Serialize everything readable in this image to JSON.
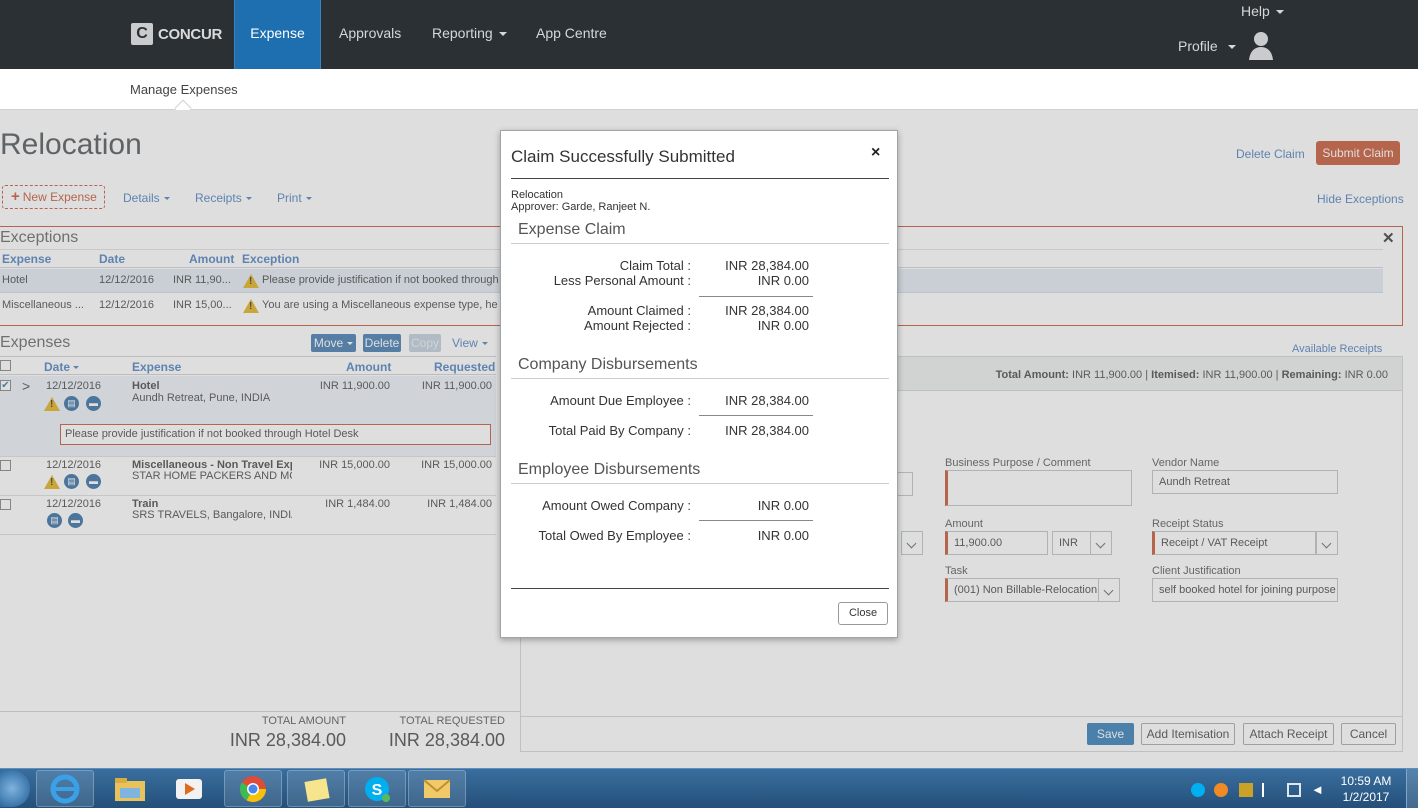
{
  "nav": {
    "logo_mark": "C",
    "logo_text": "CONCUR",
    "items": [
      "Expense",
      "Approvals",
      "Reporting",
      "App Centre"
    ],
    "help": "Help",
    "profile": "Profile"
  },
  "subnav": {
    "tab": "Manage Expenses"
  },
  "page": {
    "title": "Relocation",
    "delete_claim": "Delete Claim",
    "submit_claim": "Submit Claim",
    "new_expense": "New Expense",
    "toolbar": [
      "Details",
      "Receipts",
      "Print"
    ],
    "hide_exceptions": "Hide Exceptions"
  },
  "exceptions": {
    "title": "Exceptions",
    "headers": [
      "Expense",
      "Date",
      "Amount",
      "Exception"
    ],
    "rows": [
      {
        "expense": "Hotel",
        "date": "12/12/2016",
        "amount": "INR 11,90...",
        "text": "Please provide justification if not booked through"
      },
      {
        "expense": "Miscellaneous ...",
        "date": "12/12/2016",
        "amount": "INR 15,00...",
        "text": "You are using a Miscellaneous expense type, her"
      }
    ]
  },
  "expenses": {
    "title": "Expenses",
    "buttons": [
      "Move",
      "Delete",
      "Copy",
      "View"
    ],
    "headers": [
      "Date",
      "Expense",
      "Amount",
      "Requested"
    ],
    "rows": [
      {
        "date": "12/12/2016",
        "name": "Hotel",
        "detail": "Aundh Retreat, Pune, INDIA",
        "amount": "INR 11,900.00",
        "requested": "INR 11,900.00"
      },
      {
        "date": "12/12/2016",
        "name": "Miscellaneous - Non Travel Exp",
        "detail": "STAR HOME PACKERS AND MC",
        "amount": "INR 15,000.00",
        "requested": "INR 15,000.00"
      },
      {
        "date": "12/12/2016",
        "name": "Train",
        "detail": "SRS TRAVELS, Bangalore, INDIA",
        "amount": "INR 1,484.00",
        "requested": "INR 1,484.00"
      }
    ],
    "exception_msg": "Please provide justification if not booked through Hotel Desk",
    "total_amount_label": "TOTAL AMOUNT",
    "total_amount": "INR 28,384.00",
    "total_requested_label": "TOTAL REQUESTED",
    "total_requested": "INR 28,384.00"
  },
  "detail": {
    "available_receipts": "Available Receipts",
    "total_label": "Total Amount:",
    "total_value": "INR 11,900.00",
    "itemised_label": "Itemised:",
    "itemised_value": "INR 11,900.00",
    "remaining_label": "Remaining:",
    "remaining_value": "INR 0.00",
    "business_purpose_label": "Business Purpose / Comment",
    "business_purpose_value": "",
    "vendor_label": "Vendor Name",
    "vendor_value": "Aundh Retreat",
    "amount_label": "Amount",
    "amount_value": "11,900.00",
    "currency": "INR",
    "receipt_status_label": "Receipt Status",
    "receipt_status_value": "Receipt / VAT Receipt",
    "task_label": "Task",
    "task_value": "(001) Non Billable-Relocation",
    "client_just_label": "Client Justification",
    "client_just_value": "self booked hotel for joining purpose",
    "actions": [
      "Save",
      "Add Itemisation",
      "Attach Receipt",
      "Cancel"
    ]
  },
  "modal": {
    "title": "Claim Successfully Submitted",
    "close_x": "×",
    "report_name": "Relocation",
    "approver": "Approver: Garde, Ranjeet N.",
    "sections": {
      "expense_claim": "Expense Claim",
      "company_disb": "Company Disbursements",
      "employee_disb": "Employee Disbursements"
    },
    "claim_total_label": "Claim Total :",
    "claim_total": "INR 28,384.00",
    "less_personal_label": "Less Personal Amount :",
    "less_personal": "INR 0.00",
    "amount_claimed_label": "Amount Claimed :",
    "amount_claimed": "INR 28,384.00",
    "amount_rejected_label": "Amount Rejected :",
    "amount_rejected": "INR 0.00",
    "due_employee_label": "Amount Due Employee :",
    "due_employee": "INR 28,384.00",
    "paid_company_label": "Total Paid By Company :",
    "paid_company": "INR 28,384.00",
    "owed_company_label": "Amount Owed Company :",
    "owed_company": "INR 0.00",
    "owed_employee_label": "Total Owed By Employee :",
    "owed_employee": "INR 0.00",
    "close_button": "Close"
  },
  "taskbar": {
    "time": "10:59 AM",
    "date": "1/2/2017"
  }
}
